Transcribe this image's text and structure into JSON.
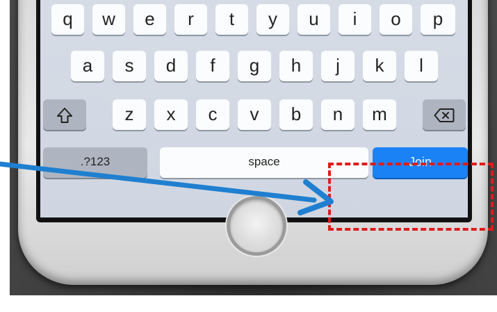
{
  "keyboard": {
    "row1": [
      "q",
      "w",
      "e",
      "r",
      "t",
      "y",
      "u",
      "i",
      "o",
      "p"
    ],
    "row2": [
      "a",
      "s",
      "d",
      "f",
      "g",
      "h",
      "j",
      "k",
      "l"
    ],
    "row3": [
      "z",
      "x",
      "c",
      "v",
      "b",
      "n",
      "m"
    ],
    "shift_icon": "shift-arrow-icon",
    "backspace_icon": "backspace-icon",
    "numbers_label": ".?123",
    "space_label": "space",
    "join_label": "Join"
  },
  "annotation": {
    "arrow_color": "#1f7fd0",
    "box_color": "#e01b1b",
    "arrow_icon": "pointer-arrow-icon"
  },
  "device": {
    "home_button_icon": "home-button-icon",
    "key_color": "#fbfcfd",
    "join_color": "#1a82f5"
  }
}
